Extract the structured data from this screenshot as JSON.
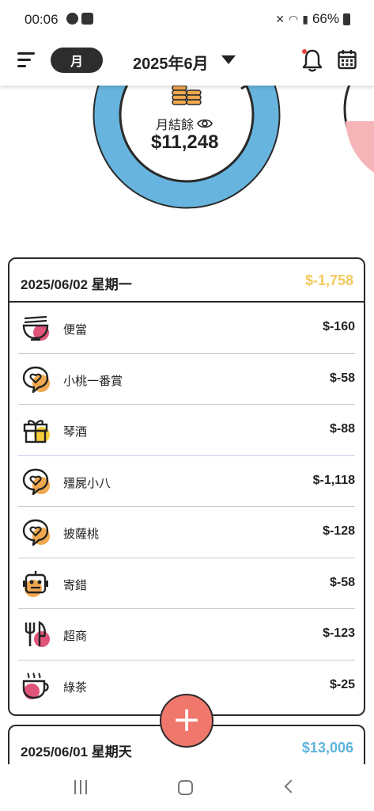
{
  "status_bar": {
    "time": "00:06",
    "battery": "66%"
  },
  "header": {
    "period": "月",
    "month": "2025年6月"
  },
  "summary": {
    "label": "月結餘",
    "balance": "$11,248"
  },
  "days": [
    {
      "date": "2025/06/02 星期一",
      "total": "$-1,758",
      "total_color": "#f3c95a",
      "transactions": [
        {
          "icon": "bento-bowl-icon",
          "name": "便當",
          "amount": "$-160"
        },
        {
          "icon": "chat-heart-icon",
          "name": "小桃一番賞",
          "amount": "$-58"
        },
        {
          "icon": "gift-icon",
          "name": "琴酒",
          "amount": "$-88"
        },
        {
          "icon": "chat-heart-icon",
          "name": "殭屍小八",
          "amount": "$-1,118"
        },
        {
          "icon": "chat-heart-icon",
          "name": "披薩桃",
          "amount": "$-128"
        },
        {
          "icon": "robot-icon",
          "name": "寄錯",
          "amount": "$-58"
        },
        {
          "icon": "fork-knife-icon",
          "name": "超商",
          "amount": "$-123"
        },
        {
          "icon": "coffee-cup-icon",
          "name": "綠茶",
          "amount": "$-25"
        }
      ]
    },
    {
      "date": "2025/06/01 星期天",
      "total": "$13,006",
      "total_color": "#5fb4dc"
    }
  ],
  "colors": {
    "donut": "#67b5de",
    "income_pie": "#f6b6b9",
    "fab": "#f0776b",
    "coins": "#f0a84e"
  }
}
